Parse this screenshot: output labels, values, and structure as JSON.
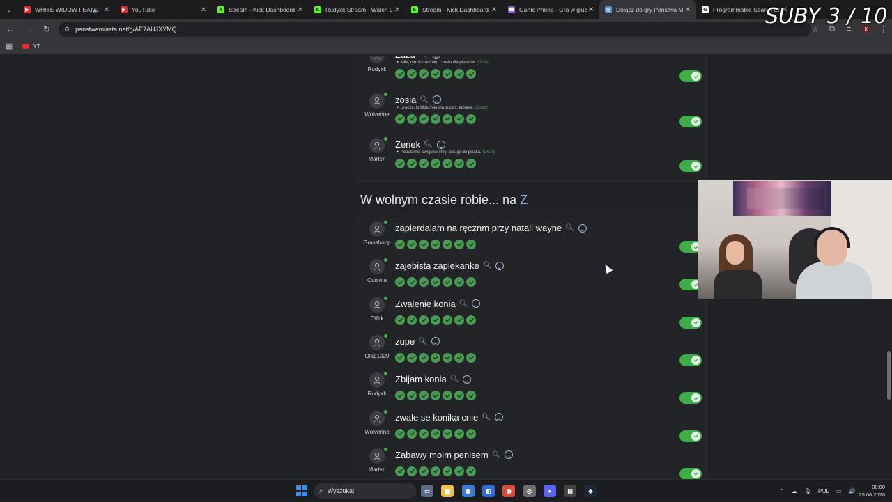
{
  "browser": {
    "tabs": [
      {
        "title": "WHITE WIDOW FEAT.",
        "favicon_color": "#e52d27",
        "favicon_glyph": "▶",
        "muted_icon": "speaker-icon",
        "active": false
      },
      {
        "title": "YouTube",
        "favicon_color": "#e52d27",
        "favicon_glyph": "▶",
        "active": false
      },
      {
        "title": "Stream - Kick Dashboard",
        "favicon_color": "#53fc18",
        "favicon_glyph": "K",
        "active": false
      },
      {
        "title": "Rudyxk Stream - Watch Li",
        "favicon_color": "#53fc18",
        "favicon_glyph": "K",
        "active": false
      },
      {
        "title": "Stream - Kick Dashboard",
        "favicon_color": "#53fc18",
        "favicon_glyph": "K",
        "active": false
      },
      {
        "title": "Gartic Phone - Gra w głuc",
        "favicon_color": "#8c5bd6",
        "favicon_glyph": "☎",
        "active": false
      },
      {
        "title": "Dołącz do gry Państwa M",
        "favicon_color": "#5b8fd6",
        "favicon_glyph": "◎",
        "active": true
      },
      {
        "title": "Programmable Search En",
        "favicon_color": "#ffffff",
        "favicon_glyph": "G",
        "active": false
      }
    ],
    "url": "panstwamiasta.net/g/AE7AHJXYMQ",
    "profile_initial": "K",
    "bookmarks": [
      {
        "label": "YT"
      }
    ]
  },
  "overlay": {
    "subs_counter": "SUBY 3 / 10"
  },
  "top_entries": [
    {
      "answer": "Zuzu",
      "player": "Rudyxk",
      "hint": "Miłe, rytmiczne imię, często dla piesków.",
      "rate": "(Oceń)",
      "votes": 7,
      "accepted": true
    },
    {
      "answer": "zosia",
      "player": "Wolverine",
      "hint": "Urocze, krótkie imię dla suczki, lubiane.",
      "rate": "(Oceń)",
      "votes": 7,
      "accepted": true
    },
    {
      "answer": "Zenek",
      "player": "Marten",
      "hint": "Popularne, swojskie imię, pasuje do psiaka.",
      "rate": "(Oceń)",
      "votes": 7,
      "accepted": true
    }
  ],
  "section": {
    "title": "W wolnym czasie robie... na",
    "letter": "Z"
  },
  "section_entries": [
    {
      "answer": "zapierdalam na ręcznm przy natali wayne",
      "player": "Grasshopp",
      "votes": 7,
      "accepted": true
    },
    {
      "answer": "zajebista zapiekanke",
      "player": "Octoma",
      "votes": 7,
      "accepted": true
    },
    {
      "answer": "Zwalenie konia",
      "player": "Offek",
      "votes": 7,
      "accepted": true
    },
    {
      "answer": "zupe",
      "player": "Olaq1029",
      "votes": 7,
      "accepted": true
    },
    {
      "answer": "Zbijam konia",
      "player": "Rudyxk",
      "votes": 7,
      "accepted": true
    },
    {
      "answer": "zwale se konika cnie",
      "player": "Wolverine",
      "votes": 7,
      "accepted": true
    },
    {
      "answer": "Zabawy moim penisem",
      "player": "Marten",
      "votes": 7,
      "accepted": true
    }
  ],
  "taskbar": {
    "search_placeholder": "Wyszukaj",
    "language": "POL",
    "time": "00:00",
    "date": "25.08.2026",
    "apps": [
      "task-view-icon",
      "file-explorer-icon",
      "store-icon",
      "outlook-icon",
      "chrome-icon",
      "app-icon",
      "discord-icon",
      "app-icon",
      "steam-icon"
    ]
  },
  "colors": {
    "accept_green": "#3fae49",
    "vote_green": "#4a9a54",
    "letter_accent": "#8fb3e6"
  }
}
